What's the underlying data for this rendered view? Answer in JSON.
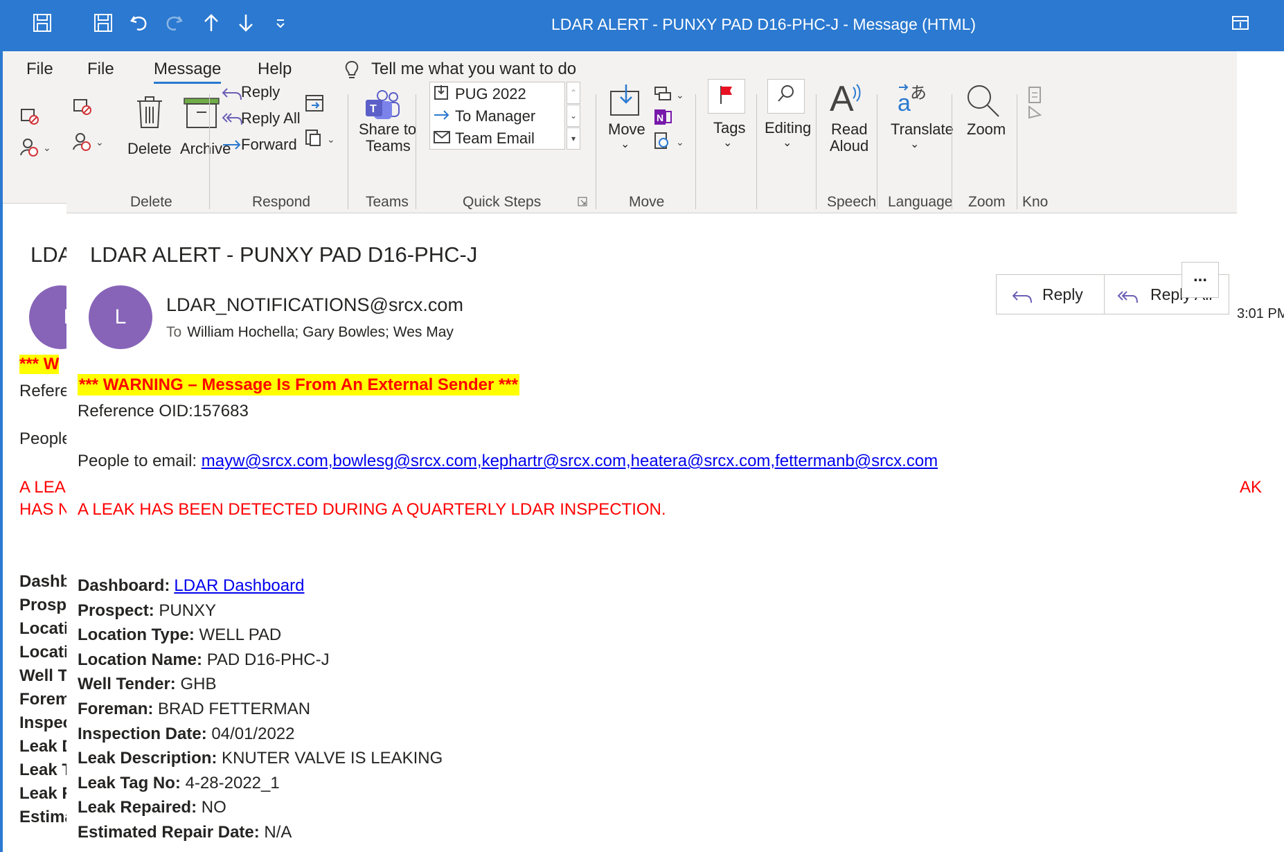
{
  "window": {
    "title": "LDAR ALERT - PUNXY PAD D16-PHC-J  -  Message (HTML)"
  },
  "menu": {
    "file": "File",
    "message": "Message",
    "help": "Help",
    "tell_me": "Tell me what you want to do"
  },
  "ribbon": {
    "delete": "Delete",
    "archive": "Archive",
    "reply": "Reply",
    "reply_all": "Reply All",
    "forward": "Forward",
    "share_to": "Share to",
    "teams": "Teams",
    "quick_steps": [
      "PUG 2022",
      "To Manager",
      "Team Email"
    ],
    "move": "Move",
    "tags": "Tags",
    "editing": "Editing",
    "read": "Read",
    "aloud": "Aloud",
    "translate": "Translate",
    "zoom": "Zoom",
    "groups": {
      "delete": "Delete",
      "respond": "Respond",
      "teams": "Teams",
      "quick_steps": "Quick Steps",
      "move": "Move",
      "speech": "Speech",
      "language": "Language",
      "zoom": "Zoom",
      "kno": "Kno"
    }
  },
  "message": {
    "subject": "LDAR ALERT - PUNXY PAD D16-PHC-J",
    "avatar_initial": "L",
    "sender": "LDAR_NOTIFICATIONS@srcx.com",
    "to_label": "To",
    "to": "William Hochella; Gary Bowles; Wes May",
    "reply_label": "Reply",
    "reply_all_label": "Reply All",
    "more_label": "...",
    "time_partial": "3:01 PM"
  },
  "body": {
    "warning": "*** WARNING – Message Is From An External Sender ***",
    "reference": "Reference OID:157683",
    "people_label": "People to email: ",
    "people_emails": "mayw@srcx.com,bowlesg@srcx.com,kephartr@srcx.com,heatera@srcx.com,fettermanb@srcx.com",
    "leak_notice": "A LEAK HAS BEEN DETECTED DURING A QUARTERLY LDAR INSPECTION.",
    "fields": [
      {
        "label": "Dashboard:",
        "value": "LDAR Dashboard"
      },
      {
        "label": "Prospect:",
        "value": " PUNXY"
      },
      {
        "label": "Location Type:",
        "value": " WELL PAD"
      },
      {
        "label": "Location Name:",
        "value": " PAD D16-PHC-J"
      },
      {
        "label": "Well Tender:",
        "value": " GHB"
      },
      {
        "label": "Foreman:",
        "value": " BRAD FETTERMAN"
      },
      {
        "label": "Inspection Date:",
        "value": " 04/01/2022"
      },
      {
        "label": "Leak Description:",
        "value": " KNUTER VALVE IS LEAKING"
      },
      {
        "label": "Leak Tag No:",
        "value": " 4-28-2022_1"
      },
      {
        "label": "Leak Repaired:",
        "value": " NO"
      },
      {
        "label": "Estimated Repair Date:",
        "value": " N/A"
      }
    ]
  },
  "background": {
    "file": "File",
    "subject_partial": "LDA",
    "avatar_initial": "L",
    "warning_partial": "*** W",
    "reference_partial": "Refere",
    "people_partial": "People",
    "leak1_partial": "A LEAK",
    "leak2_partial": "HAS N",
    "leak_right_partial": "AK",
    "labels": [
      "Dashb",
      "Prosp",
      "Locati",
      "Locati",
      "Well T",
      "Forem",
      "Inspec",
      "Leak D",
      "Leak T",
      "Leak R",
      "Estima"
    ]
  },
  "colors": {
    "title_bar": "#2b79d0",
    "ribbon_bg": "#f3f2f1",
    "avatar": "#8764b8",
    "warning_bg": "#ffff00",
    "alert_red": "#ff0000",
    "link": "#0000ee"
  }
}
